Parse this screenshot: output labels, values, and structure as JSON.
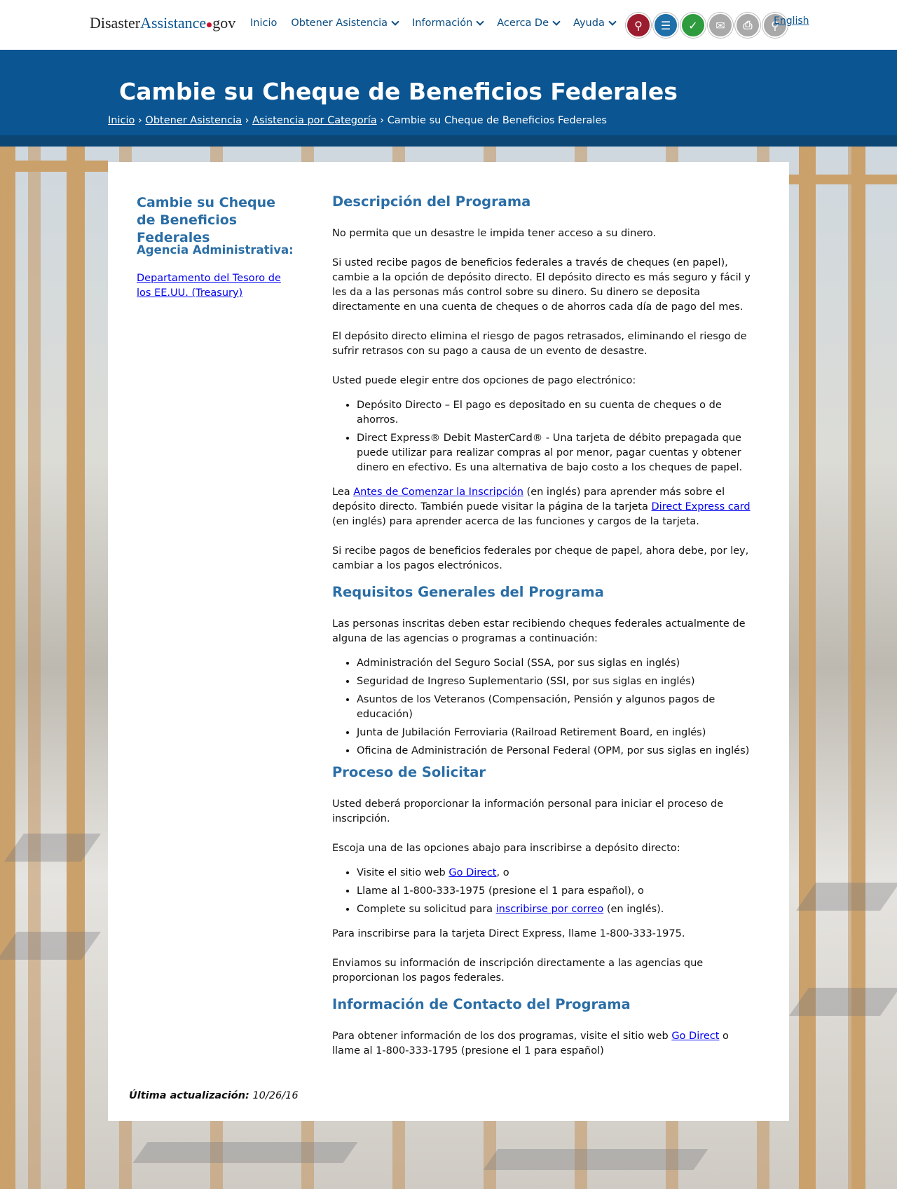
{
  "header": {
    "logo": {
      "part1": "Disaster",
      "part2": "Assistance",
      "part3": "gov"
    },
    "nav": [
      {
        "label": "Inicio",
        "dropdown": false
      },
      {
        "label": "Obtener Asistencia",
        "dropdown": true
      },
      {
        "label": "Información",
        "dropdown": true
      },
      {
        "label": "Acerca De",
        "dropdown": true
      },
      {
        "label": "Ayuda",
        "dropdown": true
      }
    ],
    "tools": [
      {
        "name": "disaster-search-icon",
        "color": "#9b1c2e",
        "glyph": "⚲"
      },
      {
        "name": "checklist-icon",
        "color": "#1f6fa8",
        "glyph": "☰"
      },
      {
        "name": "check-status-icon",
        "color": "#2e9c3e",
        "glyph": "✓"
      },
      {
        "name": "email-icon",
        "color": "#a9a9a9",
        "glyph": "✉"
      },
      {
        "name": "print-icon",
        "color": "#a9a9a9",
        "glyph": "⎙"
      },
      {
        "name": "search-icon",
        "color": "#a9a9a9",
        "glyph": "⚲"
      }
    ],
    "language_link": "English"
  },
  "banner": {
    "title": "Cambie su Cheque de Beneficios Federales",
    "breadcrumb": [
      "Inicio",
      "Obtener Asistencia",
      "Asistencia por Categoría"
    ],
    "breadcrumb_current": "Cambie su Cheque de Beneficios Federales",
    "separator": "›"
  },
  "sidebar": {
    "title": "Cambie su Cheque de Beneficios Federales",
    "agency_label": "Agencia Administrativa:",
    "agency_link": "Departamento del Tesoro de los EE.UU. (Treasury)"
  },
  "main": {
    "desc_heading": "Descripción del Programa",
    "desc_p1": "No permita que un desastre le impida tener acceso a su dinero.",
    "desc_p2": "Si usted recibe pagos de beneficios federales a través de cheques (en papel), cambie a la opción de depósito directo. El depósito directo es más seguro y fácil y les da a las personas más control sobre su dinero. Su dinero se deposita directamente en una cuenta de cheques o de ahorros cada día de pago del mes.",
    "desc_p3": "El depósito directo elimina el riesgo de pagos retrasados, eliminando el riesgo de sufrir retrasos con su pago a causa de un evento de desastre.",
    "desc_p4": "Usted puede elegir entre dos opciones de pago electrónico:",
    "desc_list": [
      "Depósito Directo – El pago es depositado en su cuenta de cheques o de ahorros.",
      "Direct Express® Debit MasterCard® - Una tarjeta de débito prepagada que puede utilizar para realizar compras al por menor, pagar cuentas y obtener dinero en efectivo. Es una alternativa de bajo costo a los cheques de papel."
    ],
    "desc_p5": {
      "t1": "Lea ",
      "link1": "Antes de Comenzar la Inscripción",
      "t2": " (en inglés) para aprender más sobre el depósito directo. También puede visitar la página de la tarjeta ",
      "link2": "Direct Express card",
      "t3": " (en inglés) para aprender acerca de las funciones y cargos de la tarjeta."
    },
    "desc_p6": "Si recibe pagos de beneficios federales por cheque de papel, ahora debe, por ley, cambiar a los pagos electrónicos.",
    "req_heading": "Requisitos Generales del Programa",
    "req_p1": "Las personas inscritas deben estar recibiendo cheques federales actualmente de alguna de las agencias o programas a continuación:",
    "req_list": [
      "Administración del Seguro Social (SSA, por sus siglas en inglés)",
      "Seguridad de Ingreso Suplementario (SSI, por sus siglas en inglés)",
      "Asuntos de los Veteranos (Compensación, Pensión y algunos pagos de educación)",
      "Junta de Jubilación Ferroviaria (Railroad Retirement Board, en inglés)",
      "Oficina de Administración de Personal Federal (OPM, por sus siglas en inglés)"
    ],
    "proc_heading": "Proceso de Solicitar",
    "proc_p1": "Usted deberá proporcionar la información personal para iniciar el proceso de inscripción.",
    "proc_p2": "Escoja una de las opciones abajo para inscribirse a depósito directo:",
    "proc_list": {
      "i1_pre": "Visite el sitio web ",
      "i1_link": "Go Direct",
      "i1_post": ", o",
      "i2": "Llame al 1-800-333-1975 (presione el 1 para español), o",
      "i3_pre": "Complete su solicitud para ",
      "i3_link": "inscribirse por correo",
      "i3_post": " (en inglés)."
    },
    "proc_p3": "Para inscribirse para la tarjeta Direct Express, llame 1-800-333-1975.",
    "proc_p4": "Enviamos su información de inscripción directamente a las agencias que proporcionan los pagos federales.",
    "contact_heading": "Información de Contacto del Programa",
    "contact_p": {
      "t1": "Para obtener información de los dos programas, visite el sitio web ",
      "link": "Go Direct",
      "t2": " o llame al 1-800-333-1795 (presione el 1 para español)"
    }
  },
  "footer": {
    "updated_label": "Última actualización:",
    "updated_date": "10/26/16"
  }
}
